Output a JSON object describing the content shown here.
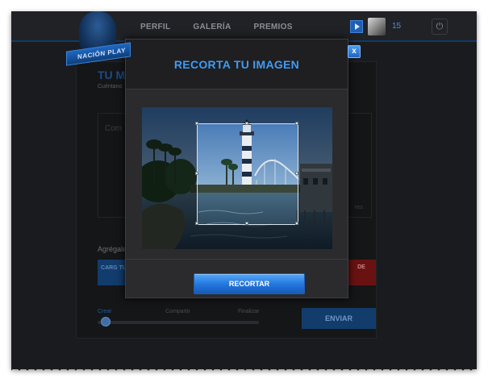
{
  "logo": {
    "text": "NACIÓN PLAY"
  },
  "nav": {
    "items": [
      "PERFIL",
      "GALERÍA",
      "PREMIOS"
    ]
  },
  "user": {
    "points": "15",
    "flag_icon": "flag-icon",
    "power_icon": "power-icon"
  },
  "background_page": {
    "title": "TU M",
    "subtitle": "Cuéntano",
    "field_placeholder": "Com",
    "counter": "res",
    "add_label": "Agrégale",
    "upload_label": "CARG TU",
    "red_button_label": "DE",
    "steps": [
      "Crear",
      "Compartir",
      "Finalizar"
    ],
    "send_label": "ENVIAR"
  },
  "modal": {
    "title": "RECORTA TU IMAGEN",
    "close_label": "x",
    "crop_button_label": "RECORTAR"
  },
  "colors": {
    "accent": "#3f9cf6",
    "button_blue": "#2275dc",
    "background": "#1a1b1e",
    "danger": "#6a1212"
  }
}
